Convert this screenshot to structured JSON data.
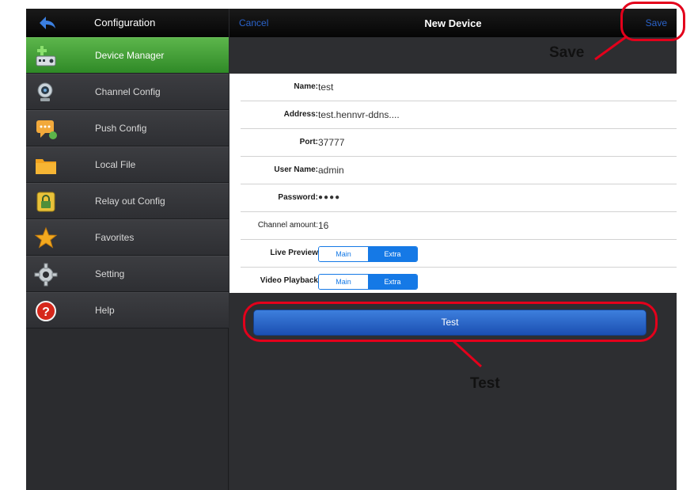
{
  "sidebar": {
    "title": "Configuration",
    "items": [
      {
        "label": "Device Manager",
        "icon": "device-manager-icon",
        "active": true
      },
      {
        "label": "Channel Config",
        "icon": "webcam-icon",
        "active": false
      },
      {
        "label": "Push Config",
        "icon": "push-message-icon",
        "active": false
      },
      {
        "label": "Local File",
        "icon": "folder-icon",
        "active": false
      },
      {
        "label": "Relay out Config",
        "icon": "lock-icon",
        "active": false
      },
      {
        "label": "Favorites",
        "icon": "star-icon",
        "active": false
      },
      {
        "label": "Setting",
        "icon": "gear-icon",
        "active": false
      },
      {
        "label": "Help",
        "icon": "help-icon",
        "active": false
      }
    ]
  },
  "header": {
    "cancel_label": "Cancel",
    "title": "New Device",
    "save_label": "Save"
  },
  "form": {
    "name": {
      "label": "Name:",
      "value": "test"
    },
    "address": {
      "label": "Address:",
      "value": "test.hennvr-ddns...."
    },
    "port": {
      "label": "Port:",
      "value": "37777"
    },
    "username": {
      "label": "User Name:",
      "value": "admin"
    },
    "password": {
      "label": "Password:",
      "value": "●●●●"
    },
    "channel_amount": {
      "label": "Channel amount:",
      "value": "16"
    },
    "live_preview": {
      "label": "Live Preview",
      "options": [
        "Main",
        "Extra"
      ],
      "selected": "Extra"
    },
    "video_playback": {
      "label": "Video Playback",
      "options": [
        "Main",
        "Extra"
      ],
      "selected": "Extra"
    }
  },
  "test_button_label": "Test",
  "annotations": {
    "save_callout": "Save",
    "test_callout": "Test"
  },
  "colors": {
    "active_nav": "#3f9e33",
    "link_blue": "#2a62c9",
    "segment_blue": "#1579e6",
    "callout_red": "#e3001b"
  }
}
